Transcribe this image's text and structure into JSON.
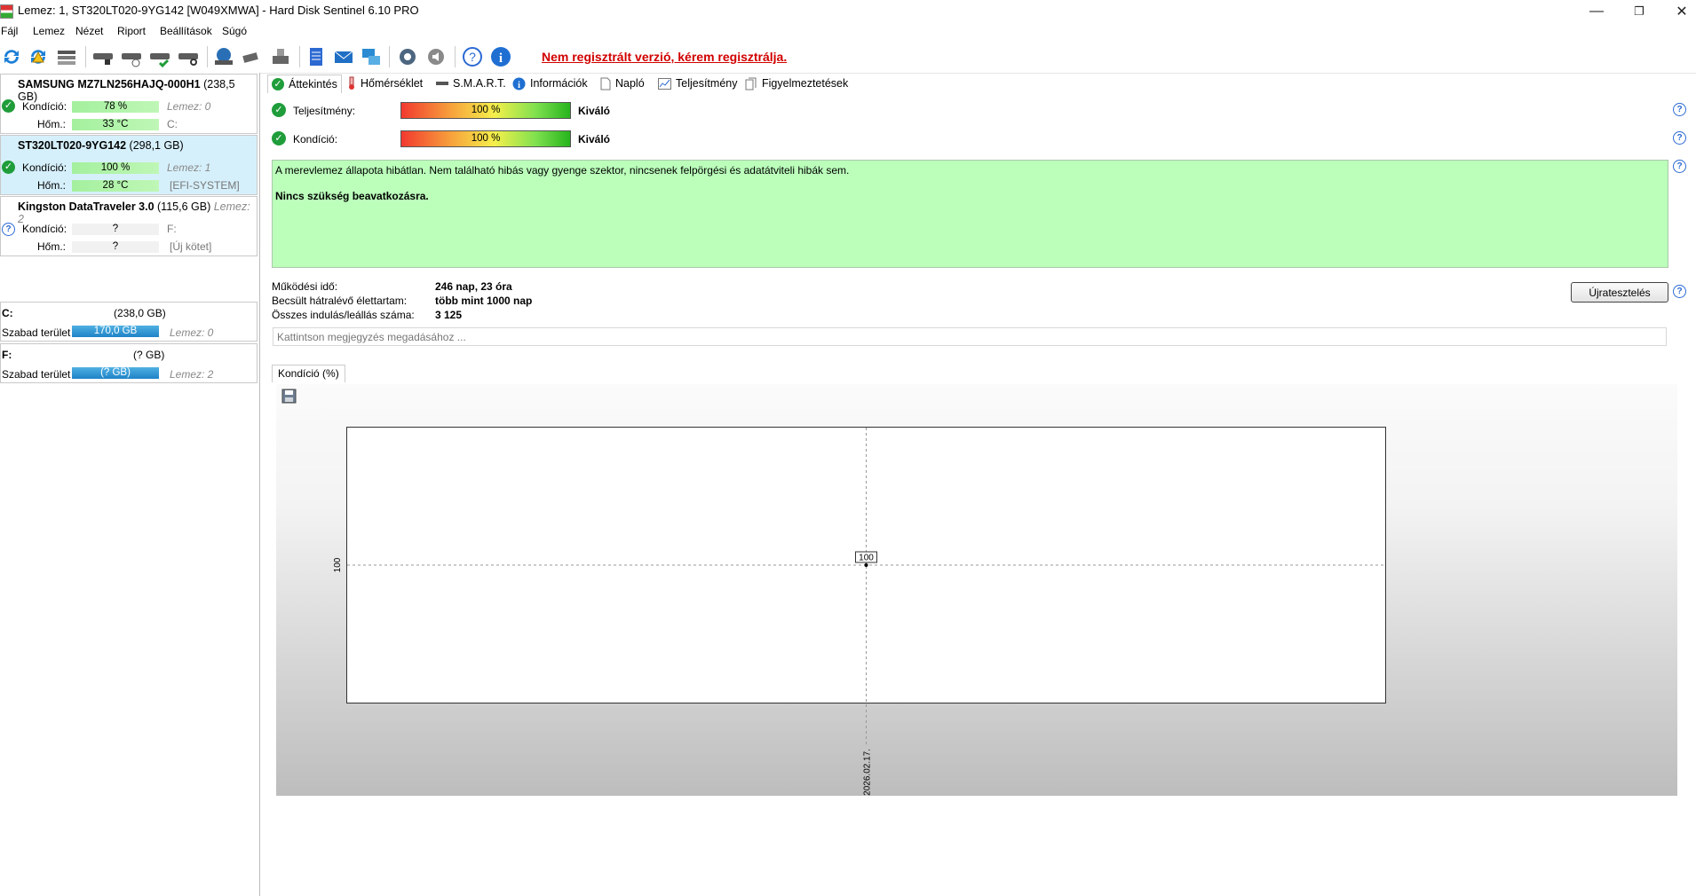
{
  "window": {
    "title": "Lemez: 1, ST320LT020-9YG142 [W049XMWA]  -  Hard Disk Sentinel 6.10 PRO",
    "min": "—",
    "max": "❐",
    "close": "✕"
  },
  "menu": [
    "Fájl",
    "Lemez",
    "Nézet",
    "Riport",
    "Beállítások",
    "Súgó"
  ],
  "toolbar": {
    "register_text": "Nem regisztrált verzió, kérem regisztrálja."
  },
  "disks": [
    {
      "name": "SAMSUNG MZ7LN256HAJQ-000H1",
      "size": "(238,5 GB)",
      "cond_label": "Kondíció:",
      "cond_value": "78 %",
      "cond_extra": "Lemez: 0",
      "temp_label": "Hőm.:",
      "temp_value": "33 °C",
      "temp_extra": "C:"
    },
    {
      "name": "ST320LT020-9YG142",
      "size": "(298,1 GB)",
      "cond_label": "Kondíció:",
      "cond_value": "100 %",
      "cond_extra": "Lemez: 1",
      "temp_label": "Hőm.:",
      "temp_value": "28 °C",
      "temp_extra": "[EFI-SYSTEM]"
    },
    {
      "name": "Kingston DataTraveler 3.0",
      "size": "(115,6 GB)",
      "disk_no": "Lemez: 2",
      "cond_label": "Kondíció:",
      "cond_value": "?",
      "cond_extra": "F:",
      "temp_label": "Hőm.:",
      "temp_value": "?",
      "temp_extra": "[Új kötet]"
    }
  ],
  "volumes": [
    {
      "letter": "C:",
      "size": "(238,0 GB)",
      "free_label": "Szabad terület",
      "free_value": "170,0 GB",
      "disk": "Lemez: 0"
    },
    {
      "letter": "F:",
      "size": "(? GB)",
      "free_label": "Szabad terület",
      "free_value": "(? GB)",
      "disk": "Lemez: 2"
    }
  ],
  "tabs": [
    "Áttekintés",
    "Hőmérséklet",
    "S.M.A.R.T.",
    "Információk",
    "Napló",
    "Teljesítmény",
    "Figyelmeztetések"
  ],
  "overview": {
    "perf_label": "Teljesítmény:",
    "perf_value": "100 %",
    "perf_rating": "Kiváló",
    "perf_level": 1.0,
    "cond_label": "Kondíció:",
    "cond_value": "100 %",
    "cond_rating": "Kiváló",
    "cond_level": 1.0,
    "status_text": "A merevlemez állapota hibátlan. Nem található hibás vagy gyenge szektor, nincsenek felpörgési és adatátviteli hibák sem.",
    "status_action": "Nincs szükség beavatkozásra.",
    "uptime_label": "Működési idő:",
    "uptime_value": "246 nap, 23 óra",
    "remaining_label": "Becsült hátralévő élettartam:",
    "remaining_value": "több mint 1000 nap",
    "starts_label": "Összes indulás/leállás száma:",
    "starts_value": "3 125",
    "retest_label": "Újratesztelés",
    "note_placeholder": "Kattintson megjegyzés megadásához ..."
  },
  "chart_tab": "Kondíció  (%)",
  "chart_data": {
    "type": "line",
    "x": [
      "2026.02.17."
    ],
    "series": [
      {
        "values": [
          100
        ]
      }
    ],
    "ytick": "100",
    "data_label": "100"
  },
  "colors": {
    "status_bg": "#bbffbb",
    "register_red": "#d10000"
  }
}
